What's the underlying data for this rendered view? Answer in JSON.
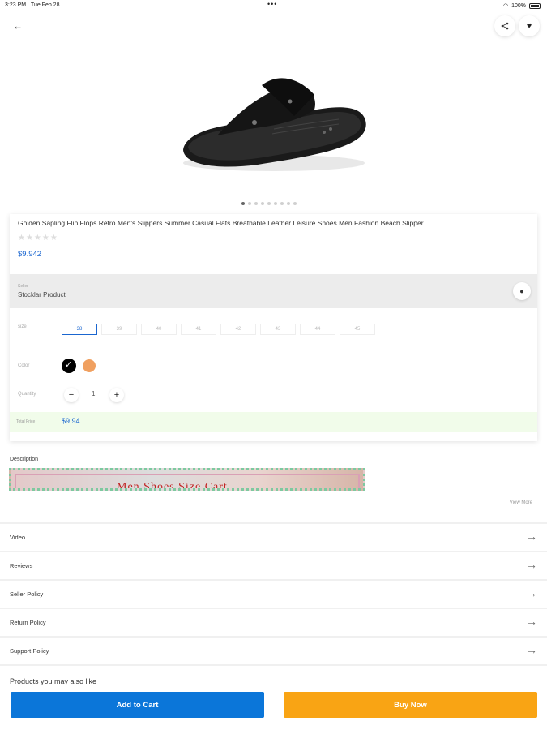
{
  "status_bar": {
    "time": "3:23 PM",
    "date": "Tue Feb 28",
    "battery": "100%"
  },
  "product": {
    "title": "Golden Sapling Flip Flops Retro Men's Slippers Summer Casual Flats Breathable Leather Leisure Shoes Men Fashion Beach Slipper",
    "rating_stars": 0,
    "price": "$9.942"
  },
  "image_pager": {
    "count": 9,
    "active": 0
  },
  "seller": {
    "label": "Seller",
    "name": "Stocklar Product"
  },
  "options": {
    "size_label": "size",
    "sizes": [
      "38",
      "39",
      "40",
      "41",
      "42",
      "43",
      "44",
      "45"
    ],
    "selected_size": "38",
    "color_label": "Color",
    "colors": [
      "#000000",
      "#f0a060"
    ],
    "selected_color": "#000000",
    "quantity_label": "Quantity",
    "quantity": "1"
  },
  "total": {
    "label": "Total Price",
    "value": "$9.94"
  },
  "description": {
    "title": "Description",
    "banner_text": "Men Shoes Size Cart",
    "view_more": "View More"
  },
  "sections": [
    "Video",
    "Reviews",
    "Seller Policy",
    "Return Policy",
    "Support Policy"
  ],
  "recommend_title": "Products you may also like",
  "actions": {
    "add_to_cart": "Add to Cart",
    "buy_now": "Buy Now"
  },
  "colors": {
    "primary": "#0b76d9",
    "buy": "#f9a414",
    "price": "#1a66d0"
  }
}
